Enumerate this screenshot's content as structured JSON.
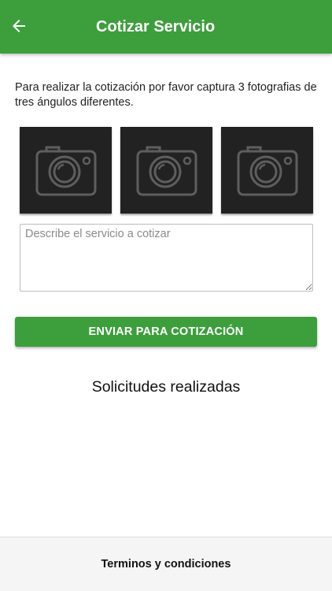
{
  "app_bar": {
    "title": "Cotizar Servicio",
    "back_icon": "arrow-left-icon",
    "background_color": "#3c9f3c"
  },
  "instructions": "Para realizar la cotización por favor captura 3 fotografias de tres ángulos diferentes.",
  "photo_slots": [
    {
      "icon": "camera-icon"
    },
    {
      "icon": "camera-icon"
    },
    {
      "icon": "camera-icon"
    }
  ],
  "description_field": {
    "placeholder": "Describe el servicio a cotizar",
    "value": ""
  },
  "submit_button": {
    "label": "ENVIAR PARA COTIZACIÓN",
    "color": "#3c9f3c"
  },
  "requests_section": {
    "title": "Solicitudes realizadas"
  },
  "footer": {
    "terms_label": "Terminos y condiciones"
  }
}
